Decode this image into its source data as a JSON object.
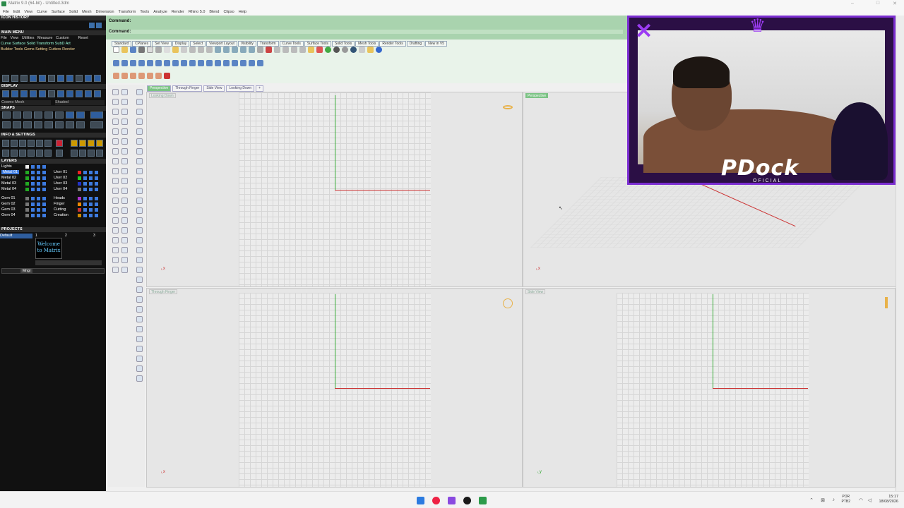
{
  "window": {
    "title": "Matrix 9.0 (64-bit) - Untitled.3dm"
  },
  "menu": [
    "File",
    "Edit",
    "View",
    "Curve",
    "Surface",
    "Solid",
    "Mesh",
    "Dimension",
    "Transform",
    "Tools",
    "Analyze",
    "Render",
    "Rhino 5.0",
    "Blend",
    "Clipso",
    "Help"
  ],
  "left_panel": {
    "icon_history": "ICON HISTORY",
    "main_menu": "MAIN MENU",
    "main_menu_items_1": [
      "File",
      "View",
      "Utilities",
      "Measure",
      "Custom",
      "Reset"
    ],
    "main_menu_items_2": [
      "Curve",
      "Surface",
      "Solid",
      "Transform",
      "SubD",
      "Art"
    ],
    "main_menu_items_3": [
      "Builder",
      "Tools",
      "Gems",
      "Setting",
      "Cutters",
      "Render"
    ],
    "display": "DISPLAY",
    "display_mode": "Cosmo Mesh",
    "display_mode2": "Shaded",
    "snaps": "SNAPS",
    "info_settings": "INFO & SETTINGS",
    "layers": "LAYERS",
    "lights": "Lights",
    "layer_rows": [
      {
        "name": "Metal 01",
        "user": "User 01"
      },
      {
        "name": "Metal 02",
        "user": "User 02"
      },
      {
        "name": "Metal 03",
        "user": "User 03"
      },
      {
        "name": "Metal 04",
        "user": "User 04"
      }
    ],
    "gem_rows": [
      {
        "name": "Gem 01",
        "user": "Heads"
      },
      {
        "name": "Gem 02",
        "user": "Finger"
      },
      {
        "name": "Gem 03",
        "user": "Cutting"
      },
      {
        "name": "Gem 04",
        "user": "Creation"
      }
    ],
    "projects": "PROJECTS",
    "project_default": "Default",
    "project_thumb_text": "Welcome to Matrix",
    "project_nums": [
      "1",
      "2",
      "3"
    ],
    "project_button": "Mngr"
  },
  "command": {
    "line1": "Command:",
    "line2": "Command:"
  },
  "toolbar_tabs": [
    "Standard",
    "CPlanes",
    "Set View",
    "Display",
    "Select",
    "Viewport Layout",
    "Visibility",
    "Transform",
    "Curve Tools",
    "Surface Tools",
    "Solid Tools",
    "Mesh Tools",
    "Render Tools",
    "Drafting",
    "New in V5"
  ],
  "viewport_tabs": [
    "Perspective",
    "Through Finger",
    "Side View",
    "Looking Down",
    "+"
  ],
  "viewports": {
    "top_left": "Looking Down",
    "top_right": "Perspective",
    "bottom_left": "Through Finger",
    "bottom_right": "Side View"
  },
  "webcam": {
    "brand": "PDock",
    "sub": "OFICIAL"
  },
  "taskbar": {
    "lang1": "POR",
    "lang2": "PTB2",
    "time": "15:17",
    "date": "18/08/2026"
  }
}
